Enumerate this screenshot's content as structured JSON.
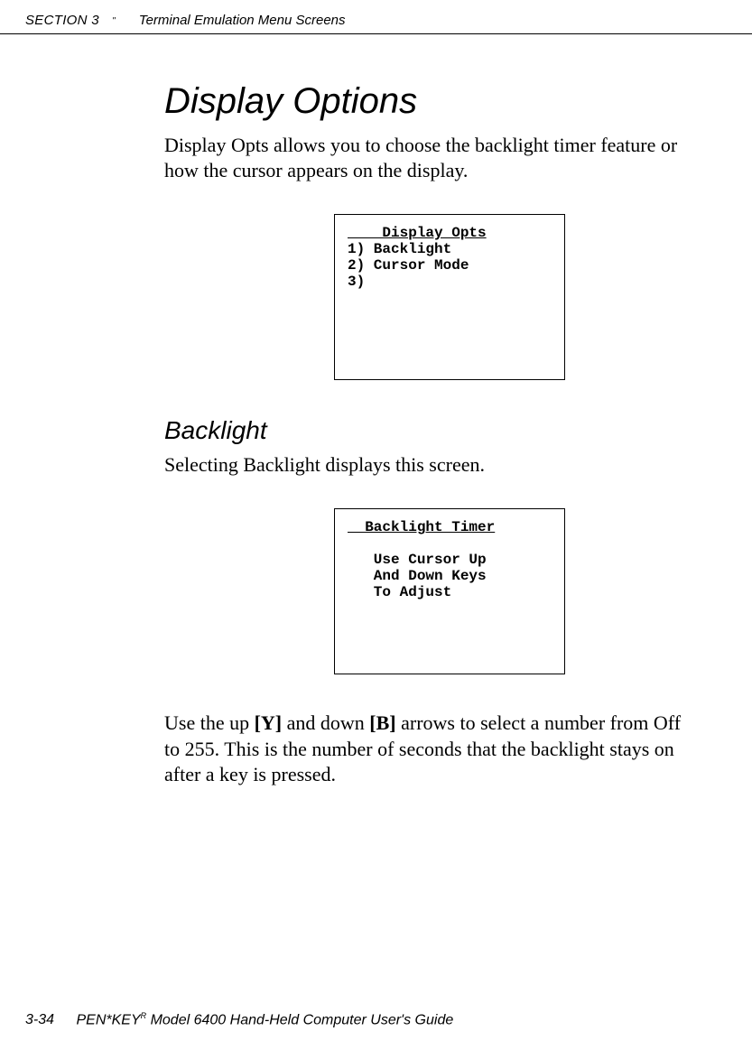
{
  "header": {
    "section": "SECTION 3",
    "quote": "\"",
    "title": "Terminal Emulation Menu Screens"
  },
  "h1": "Display Options",
  "intro": "Display Opts allows you to choose the backlight timer feature or how the cursor appears on the display.",
  "screen1": {
    "title": "    Display Opts",
    "line1": "1) Backlight",
    "line2": "2) Cursor Mode",
    "line3": "3)"
  },
  "h2": "Backlight",
  "p2": "Selecting Backlight displays this screen.",
  "screen2": {
    "title": "  Backlight Timer",
    "line1": "   Use Cursor Up",
    "line2": "   And Down Keys",
    "line3": "   To Adjust"
  },
  "para3_a": "Use the up ",
  "para3_key1": "[Y]",
  "para3_b": " and down ",
  "para3_key2": "[B]",
  "para3_c": " arrows to select a number from Off to 255.  This is the number of seconds that the backlight stays on after a key is pressed.",
  "footer": {
    "page": "3-34",
    "text_a": "PEN*KEY",
    "sup": "R",
    "text_b": " Model 6400 Hand-Held Computer User's Guide"
  }
}
